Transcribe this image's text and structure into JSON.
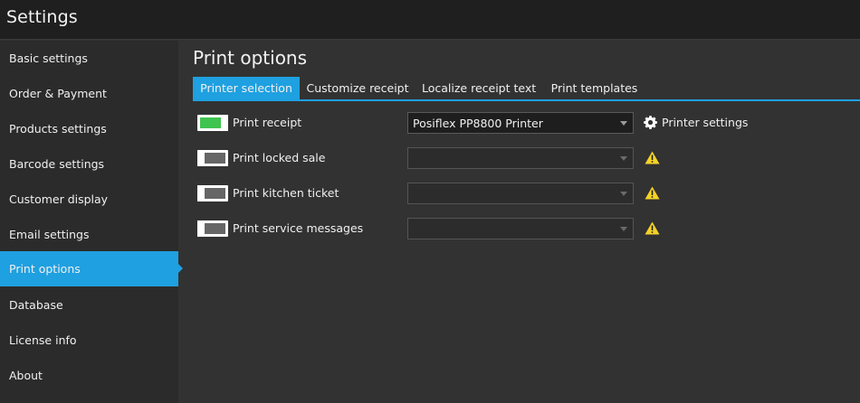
{
  "window": {
    "title": "Settings"
  },
  "sidebar": {
    "items": [
      {
        "label": "Basic settings"
      },
      {
        "label": "Order & Payment"
      },
      {
        "label": "Products settings"
      },
      {
        "label": "Barcode settings"
      },
      {
        "label": "Customer display"
      },
      {
        "label": "Email settings"
      },
      {
        "label": "Print options",
        "active": true
      },
      {
        "label": "Database"
      },
      {
        "label": "License info"
      },
      {
        "label": "About"
      }
    ]
  },
  "main": {
    "title": "Print options",
    "tabs": [
      {
        "label": "Printer selection",
        "active": true
      },
      {
        "label": "Customize receipt"
      },
      {
        "label": "Localize receipt text"
      },
      {
        "label": "Print templates"
      }
    ],
    "rows": [
      {
        "label": "Print receipt",
        "enabled": true,
        "printer": "Posiflex PP8800 Printer",
        "action": "Printer settings",
        "icon": "gear-icon"
      },
      {
        "label": "Print locked sale",
        "enabled": false,
        "printer": "",
        "icon": "warning-icon"
      },
      {
        "label": "Print kitchen ticket",
        "enabled": false,
        "printer": "",
        "icon": "warning-icon"
      },
      {
        "label": "Print service messages",
        "enabled": false,
        "printer": "",
        "icon": "warning-icon"
      }
    ]
  },
  "colors": {
    "accent": "#1fa0e0",
    "toggle_on": "#3fc44f",
    "toggle_off": "#666666",
    "warning": "#f5d327",
    "background": "#323232",
    "sidebar": "#2b2b2b",
    "titlebar": "#1f1f1f"
  }
}
